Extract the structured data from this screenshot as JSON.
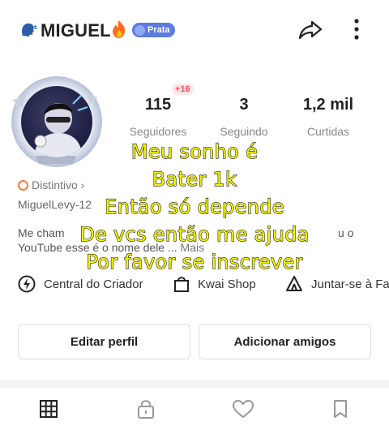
{
  "header": {
    "username": "MIGUEL",
    "badge_label": "Prata",
    "head_icon": "speaking-head-icon",
    "fire_icon": "fire-icon",
    "share_icon": "share-icon",
    "more_icon": "more-vertical-icon"
  },
  "profile": {
    "new_followers_badge": "+16",
    "stats": [
      {
        "value": "115",
        "label": "Seguidores"
      },
      {
        "value": "3",
        "label": "Seguindo"
      },
      {
        "value": "1,2 mil",
        "label": "Curtidas"
      }
    ],
    "distintivo_label": "Distintivo ›",
    "handle": "MiguelLevy-12",
    "bio_line1": "Me cham",
    "bio_line1_end": "u o",
    "bio_line2": "YouTube esse é o nome dele ...",
    "bio_more": "Mais"
  },
  "creator_row": [
    {
      "label": "Central do Criador",
      "icon": "lightning-circle-icon"
    },
    {
      "label": "Kwai Shop",
      "icon": "shopping-bag-icon"
    },
    {
      "label": "Juntar-se à Fa",
      "icon": "tent-icon"
    }
  ],
  "actions": {
    "edit_label": "Editar perfil",
    "add_friends_label": "Adicionar amigos"
  },
  "tabs": [
    {
      "icon": "grid-icon"
    },
    {
      "icon": "lock-icon"
    },
    {
      "icon": "heart-icon"
    },
    {
      "icon": "bookmark-icon"
    }
  ],
  "overlay_text": [
    "Meu sonho é",
    "Bater 1k",
    "Então só depende",
    "De vcs então me ajuda",
    "Por favor se inscrever"
  ],
  "colors": {
    "badge": "#5b7be0",
    "overlay_text": "#f4f40c",
    "plus_badge": "#ff4d5e"
  }
}
